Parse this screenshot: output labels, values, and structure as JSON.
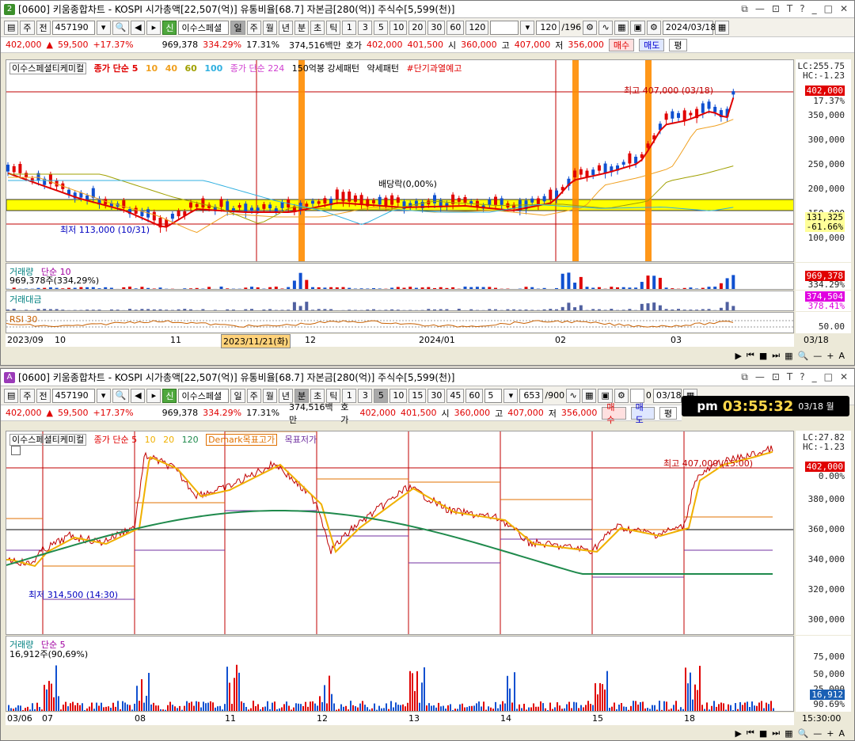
{
  "top": {
    "badge": "2",
    "title": "[0600] 키움종합차트 - KOSPI 시가총액[22,507(억)] 유통비율[68.7] 자본금[280(억)] 주식수[5,599(천)]",
    "toolbar": {
      "period_sel": "주",
      "prev": "전",
      "code": "457190",
      "name": "이수스페셜",
      "day": "일",
      "week": "주",
      "month": "월",
      "year": "년",
      "min": "분",
      "sec": "초",
      "tick": "틱",
      "n1": "1",
      "n3": "3",
      "n5": "5",
      "n10": "10",
      "n20": "20",
      "n30": "30",
      "n60": "60",
      "n120": "120",
      "count": "120",
      "total": "/196",
      "date": "2024/03/18"
    },
    "quote": {
      "price": "402,000",
      "arrow": "▲",
      "change": "59,500",
      "pct": "+17.37%",
      "volume": "969,378",
      "volratio": "334.29%",
      "turnover": "17.31%",
      "amount": "374,516백만",
      "hoga_label": "호가",
      "ask": "402,000",
      "bid": "401,500",
      "open_label": "시",
      "open": "360,000",
      "high_label": "고",
      "high": "407,000",
      "low_label": "저",
      "low": "356,000",
      "buy": "매수",
      "sell": "매도",
      "avg": "평"
    },
    "legend": {
      "name": "이수스페셜티케미컬",
      "ma": "종가 단순 5",
      "m10": "10",
      "m40": "40",
      "m60": "60",
      "m100": "100",
      "extra": "종가 단순 224",
      "p1": "150억봉 강세패턴",
      "p2": "약세패턴",
      "warn": "#단기과열예고"
    },
    "annot": {
      "high": "최고 407,000 (03/18)",
      "low": "최저 113,000 (10/31)",
      "div": "배당락(0,00%)"
    },
    "yaxis": {
      "lc": "LC:255.75",
      "hc": "HC:-1.23",
      "labels": [
        "350,000",
        "300,000",
        "250,000",
        "200,000",
        "150,000",
        "100,000"
      ],
      "pricebox": "402,000",
      "pricepct": "17.37%",
      "low_box": "131,325",
      "low_pct": "-61.66%"
    },
    "vol": {
      "label": "거래량",
      "ma": "단순 10",
      "value": "969,378주(334,29%)",
      "box": "969,378",
      "pct": "334.29%"
    },
    "amt": {
      "label": "거래대금",
      "box": "374,504",
      "pct": "378.41%"
    },
    "rsi": {
      "label": "RSI 30",
      "lab": "50.00"
    },
    "xaxis": [
      "2023/09",
      "10",
      "11",
      "2023/11/21(화)",
      "12",
      "2024/01",
      "02",
      "03",
      "03/18"
    ],
    "chart_data": {
      "type": "candlestick",
      "series": [
        {
          "name": "종가 단순 5"
        }
      ],
      "annotations": {
        "high": 407000,
        "low": 113000
      },
      "ylim": [
        100000,
        410000
      ]
    }
  },
  "bottom": {
    "badge": "A",
    "title": "[0600] 키움종합차트 - KOSPI 시가총액[22,507(억)] 유통비율[68.7] 자본금[280(억)] 주식수[5,599(천)]",
    "toolbar": {
      "period_sel": "주",
      "prev": "전",
      "code": "457190",
      "name": "이수스페셜",
      "day": "일",
      "week": "주",
      "month": "월",
      "year": "년",
      "min": "분",
      "sec": "초",
      "tick": "틱",
      "n1": "1",
      "n3": "3",
      "n5": "5",
      "n10": "10",
      "n15": "15",
      "n30": "30",
      "n45": "45",
      "n60": "60",
      "sel": "5",
      "count": "653",
      "total": "/900",
      "zero": "0",
      "date": "03/18"
    },
    "clock": {
      "ampm": "pm",
      "time": "03:55:32",
      "date": "03/18 월"
    },
    "quote": {
      "price": "402,000",
      "arrow": "▲",
      "change": "59,500",
      "pct": "+17.37%",
      "volume": "969,378",
      "volratio": "334.29%",
      "turnover": "17.31%",
      "amount": "374,516백만",
      "hoga_label": "호가",
      "ask": "402,000",
      "bid": "401,500",
      "open_label": "시",
      "open": "360,000",
      "high_label": "고",
      "high": "407,000",
      "low_label": "저",
      "low": "356,000",
      "buy": "매수",
      "sell": "매도",
      "avg": "평"
    },
    "legend": {
      "name": "이수스페셜티케미컬",
      "ma": "종가 단순 5",
      "m10": "10",
      "m20": "20",
      "m120": "120",
      "demark": "Demark목표고가",
      "demark_low": "목표저가"
    },
    "annot": {
      "high": "최고 407,000 (15:00)",
      "low": "최저 314,500 (14:30)"
    },
    "yaxis": {
      "lc": "LC:27.82",
      "hc": "HC:-1.23",
      "labels": [
        "380,000",
        "360,000",
        "340,000",
        "320,000",
        "300,000"
      ],
      "pricebox": "402,000",
      "pricepct": "0.00%"
    },
    "vol": {
      "label": "거래량",
      "ma": "단순 5",
      "value": "16,912주(90,69%)",
      "labels": [
        "75,000",
        "50,000",
        "25,000"
      ],
      "box": "16,912",
      "pct": "90.69%"
    },
    "xaxis": [
      "03/06",
      "07",
      "08",
      "11",
      "12",
      "13",
      "14",
      "15",
      "18",
      "15:30:00"
    ],
    "chart_data": {
      "type": "candlestick",
      "series": [
        {
          "name": "종가 단순 5"
        }
      ],
      "annotations": {
        "high": 407000,
        "low": 314500
      },
      "ylim": [
        290000,
        410000
      ]
    }
  }
}
